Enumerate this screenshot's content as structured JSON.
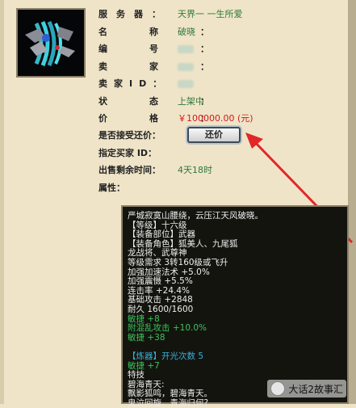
{
  "fields": {
    "server_label": "服务器：",
    "server_value": "天界一 一生所爱",
    "name_label": "名称：",
    "name_value": "破晓",
    "id_label": "编号：",
    "seller_label": "卖家：",
    "seller_id_label": "卖家ID：",
    "status_label": "状态：",
    "status_value": "上架中",
    "price_label": "价格：",
    "price_value": "￥100000.00 (元)",
    "haggle_label": "是否接受还价：",
    "haggle_button": "还价",
    "buyer_label": "指定买家 ID：",
    "time_label": "出售剩余时间：",
    "time_value": "4天18时",
    "attr_label": "属性："
  },
  "description": [
    {
      "text": "严城寂寞山腰绕，云压江天风破晓。",
      "color": "white"
    },
    {
      "text": "【等级】十六级",
      "color": "white"
    },
    {
      "text": "【装备部位】武器",
      "color": "white"
    },
    {
      "text": "【装备角色】狐美人、九尾狐",
      "color": "white"
    },
    {
      "text": "龙战将、武尊神",
      "color": "white"
    },
    {
      "text": "等级需求 3转160级或飞升",
      "color": "white"
    },
    {
      "text": "加强加速法术 +5.0%",
      "color": "white"
    },
    {
      "text": "加强震慑 +5.5%",
      "color": "white"
    },
    {
      "text": "连击率 +24.4%",
      "color": "white"
    },
    {
      "text": "基础攻击 +2848",
      "color": "white"
    },
    {
      "text": "耐久 1600/1600",
      "color": "white"
    },
    {
      "text": "敏捷 +8",
      "color": "green"
    },
    {
      "text": "附混乱攻击 +10.0%",
      "color": "green"
    },
    {
      "text": "敏捷 +38",
      "color": "green"
    },
    {
      "text": "",
      "color": "white"
    },
    {
      "text": "【炼器】开光次数 5",
      "color": "cyan"
    },
    {
      "text": "敏捷 +7",
      "color": "green"
    },
    {
      "text": "特技",
      "color": "white"
    },
    {
      "text": "碧海青天:",
      "color": "white"
    },
    {
      "text": "飘影狐鸣，碧海青天。",
      "color": "white"
    },
    {
      "text": "鬼泣回旋，青海归何?",
      "color": "white"
    }
  ],
  "watermark": "大话2故事汇"
}
